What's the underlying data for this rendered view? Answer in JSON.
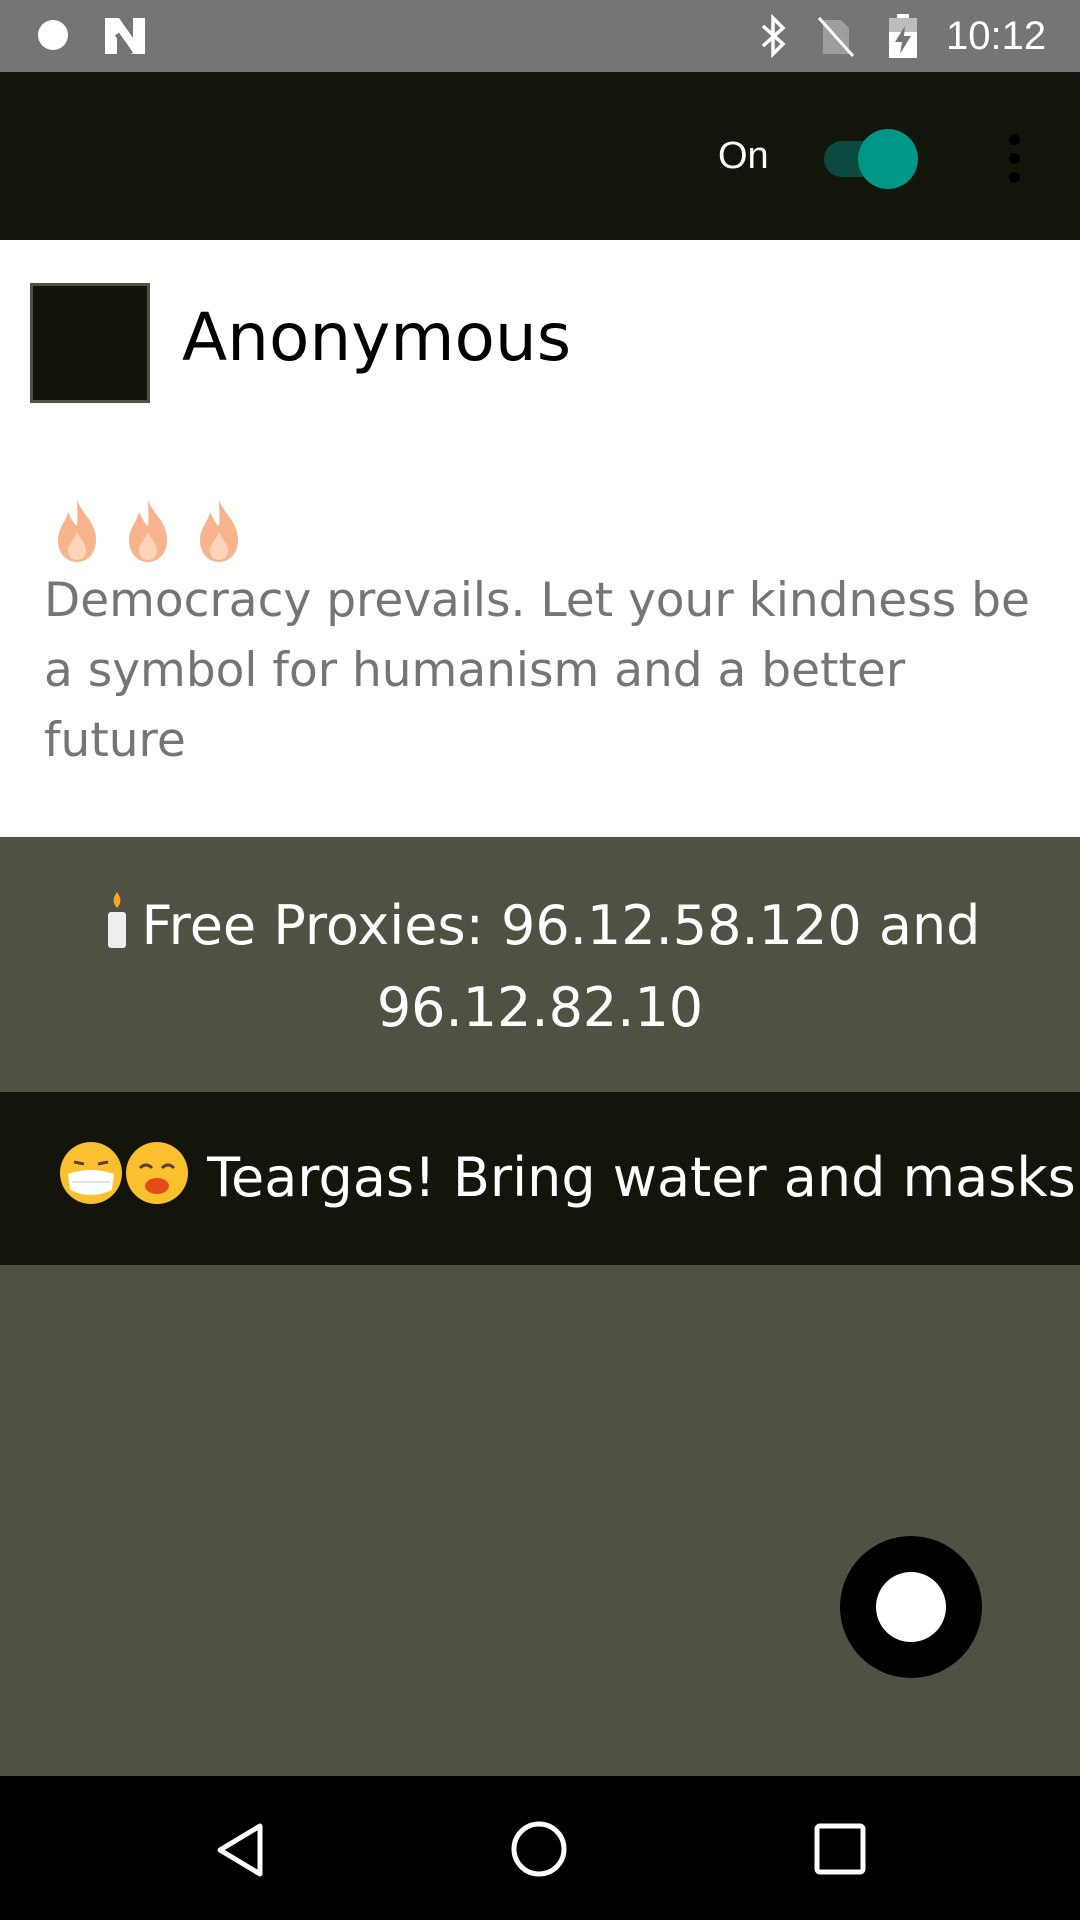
{
  "status_bar": {
    "time": "10:12",
    "icons": [
      "notification-dot-icon",
      "n-logo-icon",
      "bluetooth-icon",
      "no-sim-icon",
      "battery-charging-icon"
    ]
  },
  "app_bar": {
    "toggle_label": "On",
    "toggle_state": true,
    "accent_color": "#009688",
    "menu_icon": "more-vert-icon"
  },
  "message": {
    "author": "Anonymous",
    "emoji": [
      "fire",
      "fire",
      "fire"
    ],
    "text": "Democracy prevails. Let your kindness be a symbol for humanism and a better future"
  },
  "banners": [
    {
      "emoji": [
        "candle"
      ],
      "text": "Free Proxies: 96.12.58.120 and 96.12.82.10"
    },
    {
      "emoji": [
        "mask-face",
        "weary-face"
      ],
      "text": "Teargas! Bring water and masks"
    }
  ],
  "fab": {
    "icon": "record-icon"
  },
  "nav_bar": {
    "icons": [
      "back-icon",
      "home-icon",
      "recents-icon"
    ]
  }
}
